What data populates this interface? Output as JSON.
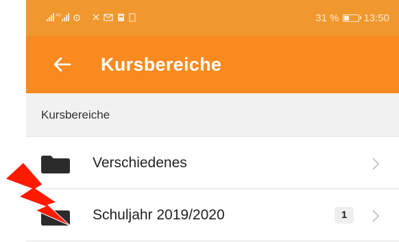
{
  "statusbar": {
    "left_text": "´∥∥∥ ∥∥∥ ◎¹ ⌁ ✉ Б ▣",
    "battery": "31 %",
    "time": "13:50",
    "battery_level": 0.31
  },
  "appbar": {
    "title": "Kursbereiche",
    "back_icon": "arrow-left-icon"
  },
  "section": {
    "header": "Kursbereiche"
  },
  "items": [
    {
      "label": "Verschiedenes",
      "icon": "folder-icon",
      "badge": ""
    },
    {
      "label": "Schuljahr 2019/2020",
      "icon": "folder-icon",
      "badge": "1"
    }
  ],
  "colors": {
    "statusbar": "#f0982e",
    "appbar": "#f98a1f",
    "lightning": "#ff1a00"
  }
}
